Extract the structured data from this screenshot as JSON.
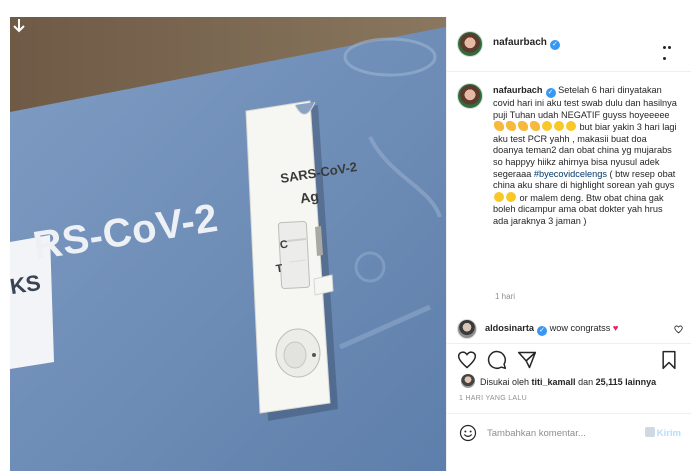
{
  "post": {
    "username": "nafaurbach",
    "verified_mark": "✓",
    "photo_texts": {
      "box_brand": "RS-CoV-2",
      "box_side": "KS",
      "cassette_title": "SARS-CoV-2",
      "cassette_sub": "Ag",
      "cassette_c": "C",
      "cassette_t": "T"
    }
  },
  "caption": {
    "username": "nafaurbach",
    "text_1": " Setelah 6 hari dinyatakan covid hari ini aku test swab dulu dan hasilnya puji Tuhan udah NEGATIF guyss hoyeeeee ",
    "text_2": " but biar yakin 3 hari lagi aku test PCR yahh , makasii buat doa doanya teman2 dan obat china yg mujarabs so happyy hiikz ahirnya bisa nyusul adek segeraaa ",
    "hashtag": "#byecovidcelengs",
    "text_3": " ( btw resep obat china aku share di highlight sorean yah guys ",
    "text_4": " or malem deng. Btw obat china gak boleh dicampur ama obat dokter yah hrus ada jaraknya 3 jaman )",
    "time": "1 hari"
  },
  "comment": {
    "username": "aldosinarta",
    "text": " wow congratss",
    "heart": "♥"
  },
  "likes": {
    "prefix": "Disukai oleh ",
    "user": "titi_kamall",
    "middle": " dan ",
    "count": "25,115 lainnya"
  },
  "post_time": "1 HARI YANG LALU",
  "add_comment": {
    "placeholder": "Tambahkan komentar...",
    "button": "Kirim"
  },
  "icons": {
    "download": "download-arrow-icon",
    "more": "more-options-icon",
    "like": "heart-icon",
    "comment": "comment-bubble-icon",
    "share": "paper-plane-icon",
    "save": "bookmark-icon",
    "emoji": "smiley-icon"
  },
  "colors": {
    "link": "#00376b",
    "verified": "#3897f0",
    "muted": "#8e8e8e",
    "post_button": "#b2dffc"
  }
}
